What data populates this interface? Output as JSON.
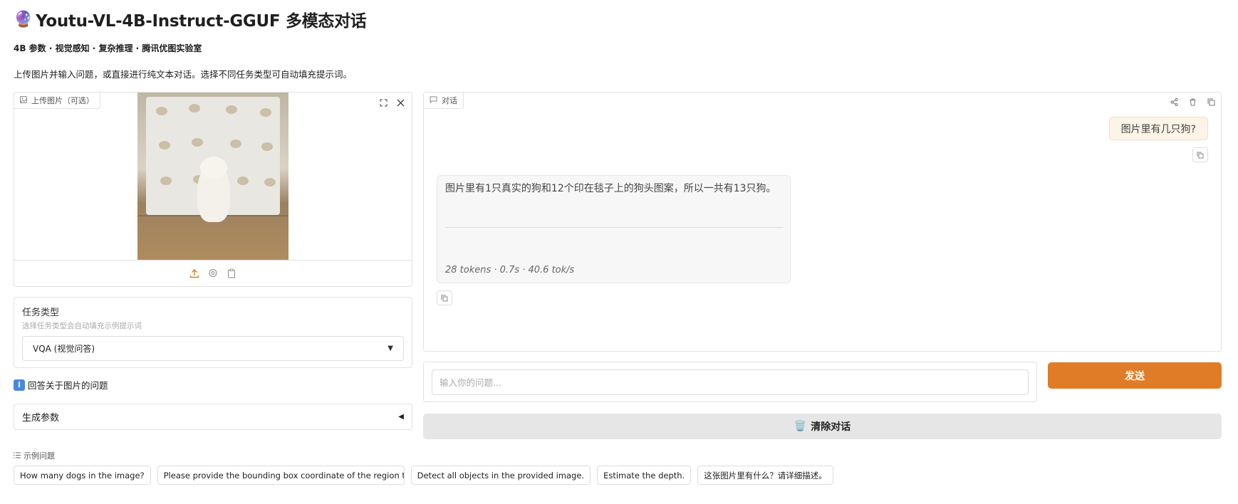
{
  "header": {
    "title": "Youtu-VL-4B-Instruct-GGUF 多模态对话",
    "subtitle": "4B 参数 · 视觉感知 · 复杂推理 · 腾讯优图实验室",
    "description": "上传图片并输入问题，或直接进行纯文本对话。选择不同任务类型可自动填充提示词。"
  },
  "upload": {
    "label": "上传图片（可选）"
  },
  "task": {
    "label": "任务类型",
    "info": "选择任务类型会自动填充示例提示词",
    "selected": "VQA (视觉问答)"
  },
  "hint": {
    "icon": "ℹ️",
    "text": "回答关于图片的问题"
  },
  "generation": {
    "label": "生成参数"
  },
  "chat": {
    "label": "对话",
    "messages": [
      {
        "role": "user",
        "text": "图片里有几只狗?"
      },
      {
        "role": "assistant",
        "text": "图片里有1只真实的狗和12个印在毯子上的狗头图案，所以一共有13只狗。",
        "meta": "28 tokens · 0.7s · 40.6 tok/s"
      }
    ]
  },
  "input": {
    "placeholder": "输入你的问题..."
  },
  "buttons": {
    "send": "发送",
    "clear": "清除对话"
  },
  "examples": {
    "label": "示例问题",
    "items": [
      "How many dogs in the image?",
      "Please provide the bounding box coordinate of the region thi...",
      "Detect all objects in the provided image.",
      "Estimate the depth.",
      "这张图片里有什么？请详细描述。"
    ]
  },
  "colors": {
    "accent": "#e07c28",
    "user_bubble": "#fdf4e8",
    "bot_bubble": "#f7f7f7",
    "clear_button": "#e6e6e6"
  }
}
